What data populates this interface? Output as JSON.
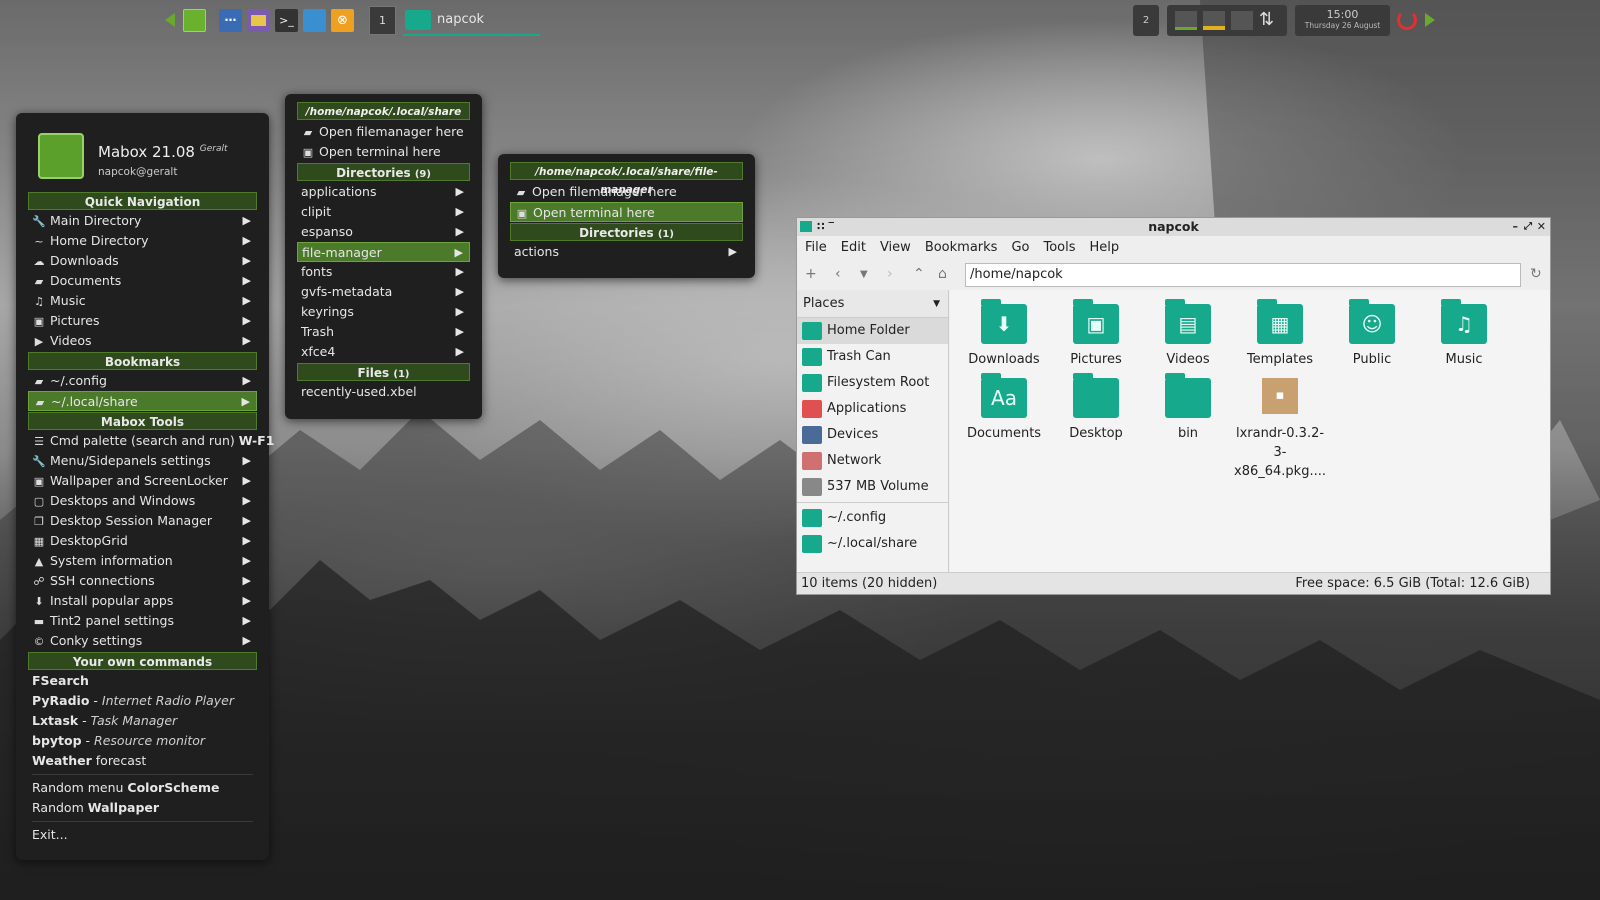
{
  "panel": {
    "workspace_left": "1",
    "task_title": "napcok",
    "workspace_right": "2",
    "clock_time": "15:00",
    "clock_date": "Thursday 26 August",
    "icons": [
      "arrow-left-icon",
      "mabox-logo-icon",
      "dots-icon",
      "files-icon",
      "terminal-icon",
      "network-icon",
      "package-icon",
      "power-icon",
      "arrow-right-icon"
    ]
  },
  "main_menu": {
    "app_name": "Mabox 21.08",
    "codename": "Geralt",
    "user": "napcok@geralt",
    "quick_nav_header": "Quick Navigation",
    "quick_nav": [
      {
        "icon": "wrench-icon",
        "glyph": "🔧",
        "label": "Main Directory"
      },
      {
        "icon": "tilde-icon",
        "glyph": "~",
        "label": "Home Directory"
      },
      {
        "icon": "cloud-download-icon",
        "glyph": "☁",
        "label": "Downloads"
      },
      {
        "icon": "folder-icon",
        "glyph": "▰",
        "label": "Documents"
      },
      {
        "icon": "headphones-icon",
        "glyph": "♫",
        "label": "Music"
      },
      {
        "icon": "camera-icon",
        "glyph": "▣",
        "label": "Pictures"
      },
      {
        "icon": "video-icon",
        "glyph": "▶",
        "label": "Videos"
      }
    ],
    "bookmarks_header": "Bookmarks",
    "bookmarks": [
      {
        "icon": "folder-open-icon",
        "glyph": "▰",
        "label": "~/.config"
      },
      {
        "icon": "folder-open-icon",
        "glyph": "▰",
        "label": "~/.local/share"
      }
    ],
    "tools_header": "Mabox Tools",
    "tools": [
      {
        "icon": "signpost-icon",
        "glyph": "☰",
        "label": "Cmd palette (search and run)",
        "hotkey": "W-F1"
      },
      {
        "icon": "wrench-icon",
        "glyph": "🔧",
        "label": "Menu/Sidepanels settings"
      },
      {
        "icon": "image-icon",
        "glyph": "▣",
        "label": "Wallpaper and ScreenLocker"
      },
      {
        "icon": "window-icon",
        "glyph": "▢",
        "label": "Desktops and Windows"
      },
      {
        "icon": "copy-icon",
        "glyph": "❐",
        "label": "Desktop Session Manager"
      },
      {
        "icon": "grid-icon",
        "glyph": "▦",
        "label": "DesktopGrid"
      },
      {
        "icon": "linux-icon",
        "glyph": "▲",
        "label": "System information"
      },
      {
        "icon": "sitemap-icon",
        "glyph": "☍",
        "label": "SSH connections"
      },
      {
        "icon": "download-box-icon",
        "glyph": "⬇",
        "label": "Install popular apps"
      },
      {
        "icon": "panel-icon",
        "glyph": "▬",
        "label": "Tint2 panel settings"
      },
      {
        "icon": "copyright-icon",
        "glyph": "©",
        "label": "Conky settings"
      }
    ],
    "own_header": "Your own commands",
    "own": [
      {
        "bold": "FSearch",
        "rest": ""
      },
      {
        "bold": "PyRadio",
        "rest": "Internet Radio Player"
      },
      {
        "bold": "Lxtask",
        "rest": "Task Manager"
      },
      {
        "bold": "bpytop",
        "rest": "Resource monitor"
      },
      {
        "bold": "Weather",
        "rest": "forecast"
      }
    ],
    "random_menu_prefix": "Random menu",
    "random_menu_bold": "ColorScheme",
    "random_wall_prefix": "Random",
    "random_wall_bold": "Wallpaper",
    "exit": "Exit..."
  },
  "sub_menu": {
    "path": "/home/napcok/.local/share",
    "open_fm": "Open filemanager here",
    "open_term": "Open terminal here",
    "dirs_header": "Directories",
    "dirs_count": "(9)",
    "dirs": [
      "applications",
      "clipit",
      "espanso",
      "file-manager",
      "fonts",
      "gvfs-metadata",
      "keyrings",
      "Trash",
      "xfce4"
    ],
    "files_header": "Files",
    "files_count": "(1)",
    "files": [
      "recently-used.xbel"
    ]
  },
  "sub_menu2": {
    "path": "/home/napcok/.local/share/file-manager",
    "open_fm": "Open filemanager here",
    "open_term": "Open terminal here",
    "dirs_header": "Directories",
    "dirs_count": "(1)",
    "dirs": [
      "actions"
    ]
  },
  "file_manager": {
    "title": "napcok",
    "menus": [
      "File",
      "Edit",
      "View",
      "Bookmarks",
      "Go",
      "Tools",
      "Help"
    ],
    "address": "/home/napcok",
    "places_header": "Places",
    "places": [
      {
        "label": "Home Folder",
        "color": "#16a98b"
      },
      {
        "label": "Trash Can",
        "color": "#16a98b"
      },
      {
        "label": "Filesystem Root",
        "color": "#16a98b"
      },
      {
        "label": "Applications",
        "color": "#e05050"
      },
      {
        "label": "Devices",
        "color": "#4a6a9a"
      },
      {
        "label": "Network",
        "color": "#d07070"
      },
      {
        "label": "537 MB Volume",
        "color": "#888888"
      }
    ],
    "bookmarks": [
      {
        "label": "~/.config",
        "color": "#16a98b"
      },
      {
        "label": "~/.local/share",
        "color": "#16a98b"
      }
    ],
    "items": [
      {
        "label": "Downloads",
        "glyph": "⬇"
      },
      {
        "label": "Pictures",
        "glyph": "▣"
      },
      {
        "label": "Videos",
        "glyph": "▤"
      },
      {
        "label": "Templates",
        "glyph": "▦"
      },
      {
        "label": "Public",
        "glyph": "☺"
      },
      {
        "label": "Music",
        "glyph": "♫"
      },
      {
        "label": "Documents",
        "glyph": "Aa"
      },
      {
        "label": "Desktop",
        "glyph": ""
      },
      {
        "label": "bin",
        "glyph": ""
      },
      {
        "label": "lxrandr-0.3.2-3-x86_64.pkg....",
        "glyph": "▪"
      }
    ],
    "status_left": "10 items (20 hidden)",
    "status_right": "Free space: 6.5 GiB (Total: 12.6 GiB)"
  },
  "colors": {
    "accent": "#4c7a2b",
    "teal": "#16a98b"
  }
}
